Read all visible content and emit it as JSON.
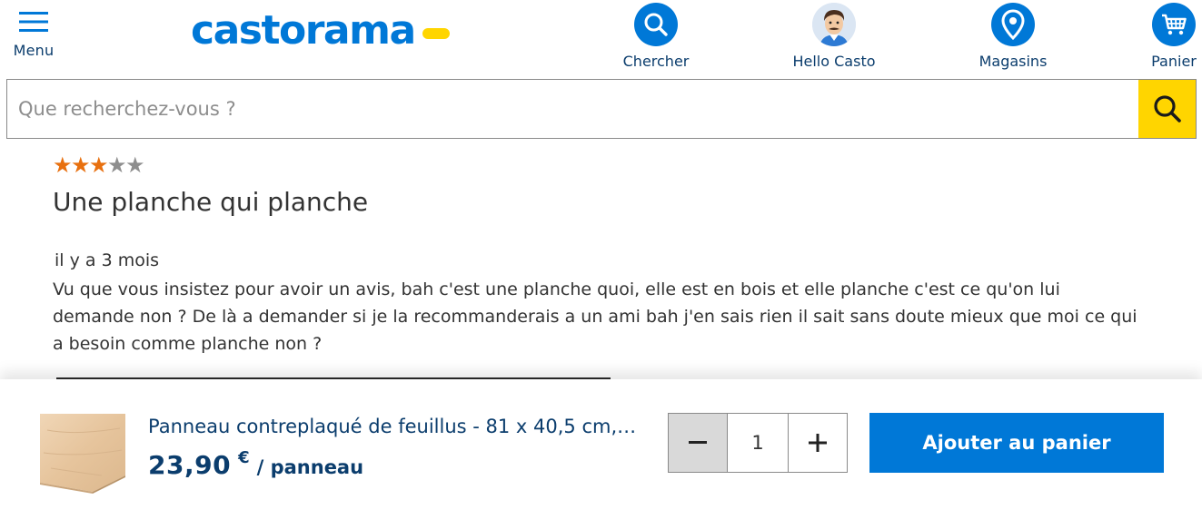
{
  "header": {
    "menu_label": "Menu",
    "logo_text": "castorama",
    "nav": {
      "search_label": "Chercher",
      "hello_label": "Hello Casto",
      "stores_label": "Magasins",
      "cart_label": "Panier"
    }
  },
  "search": {
    "placeholder": "Que recherchez-vous ?",
    "value": ""
  },
  "review": {
    "rating": 3,
    "rating_max": 5,
    "title": "Une planche qui planche",
    "date": "il y a 3 mois",
    "body": "Vu que vous insistez pour avoir un avis, bah c'est une planche quoi, elle est en bois et elle planche c'est ce qu'on lui demande non ? De là a demander si je la recommanderais a un ami bah j'en sais rien il sait sans doute mieux que moi ce qui a besoin comme planche non ?"
  },
  "sticky_bar": {
    "product_name": "Panneau contreplaqué de feuillus - 81 x 40,5 cm, ...",
    "price": "23,90",
    "currency": "€",
    "unit": "/ panneau",
    "quantity": "1",
    "add_to_cart_label": "Ajouter au panier"
  },
  "colors": {
    "brand_blue": "#0078d7",
    "navy_text": "#0b3d6d",
    "accent_yellow": "#ffd500",
    "star_active": "#e8700f",
    "star_inactive": "#8e8e8e"
  },
  "icons": {
    "menu": "hamburger-icon",
    "search": "search-icon",
    "hello": "avatar-icon",
    "stores": "location-pin-icon",
    "cart": "cart-icon",
    "search_button": "search-icon",
    "minus": "minus-icon",
    "plus": "plus-icon"
  }
}
